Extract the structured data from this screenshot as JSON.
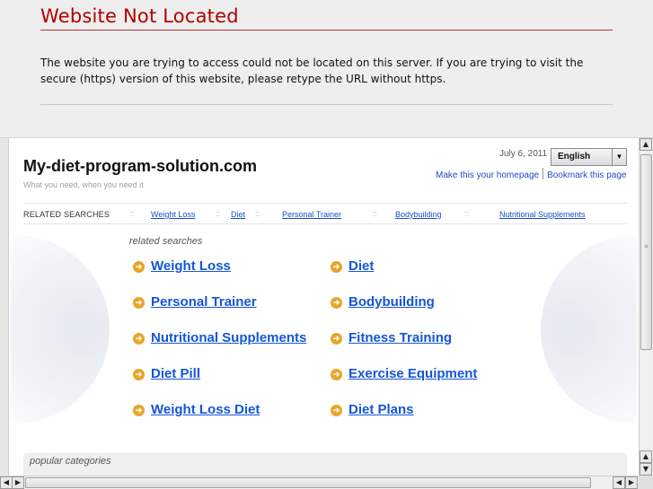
{
  "error": {
    "title": "Website Not Located",
    "message": "The website you are trying to access could not be located on this server. If you are trying to visit the secure (https) version of this website, please retype the URL without https."
  },
  "site": {
    "title": "My-diet-program-solution.com",
    "tagline": "What you need, when you need it",
    "date": "July 6, 2011",
    "language": "English",
    "homepage_link": "Make this your homepage",
    "bookmark_link": "Bookmark this page"
  },
  "related_bar": {
    "label": "RELATED SEARCHES",
    "separator": "::",
    "items": [
      "Weight Loss",
      "Diet",
      "Personal Trainer",
      "Bodybuilding",
      "Nutritional Supplements"
    ]
  },
  "related": {
    "heading": "related searches",
    "left": [
      "Weight Loss",
      "Personal Trainer",
      "Nutritional Supplements",
      "Diet Pill",
      "Weight Loss Diet"
    ],
    "right": [
      "Diet",
      "Bodybuilding",
      "Fitness Training",
      "Exercise Equipment",
      "Diet Plans"
    ]
  },
  "popular": {
    "heading": "popular categories"
  },
  "icons": {
    "arrow": "arrow-right-circle-icon",
    "dropdown": "chevron-down-icon",
    "accent": "#e8a52a",
    "link_color": "#1556d6",
    "error_color": "#b20000"
  }
}
